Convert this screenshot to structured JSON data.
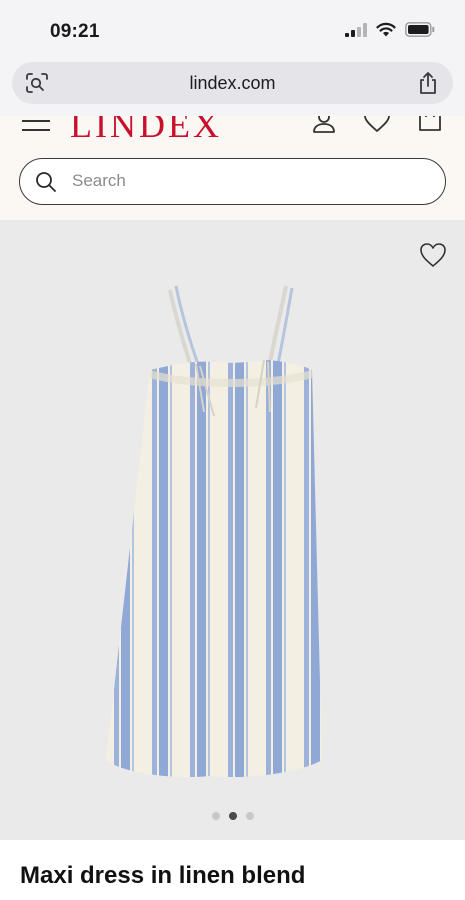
{
  "status_bar": {
    "time": "09:21"
  },
  "browser": {
    "url": "lindex.com"
  },
  "site": {
    "logo": "LINDEX"
  },
  "search": {
    "placeholder": "Search"
  },
  "product": {
    "title": "Maxi dress in linen blend",
    "image_count": 3,
    "active_image_index": 2,
    "stripe_colors": [
      "#f3efe2",
      "#8fa8d6"
    ]
  },
  "colors": {
    "brand": "#c8102e",
    "header_bg": "#fbf8f3",
    "image_bg": "#eaeaea"
  }
}
